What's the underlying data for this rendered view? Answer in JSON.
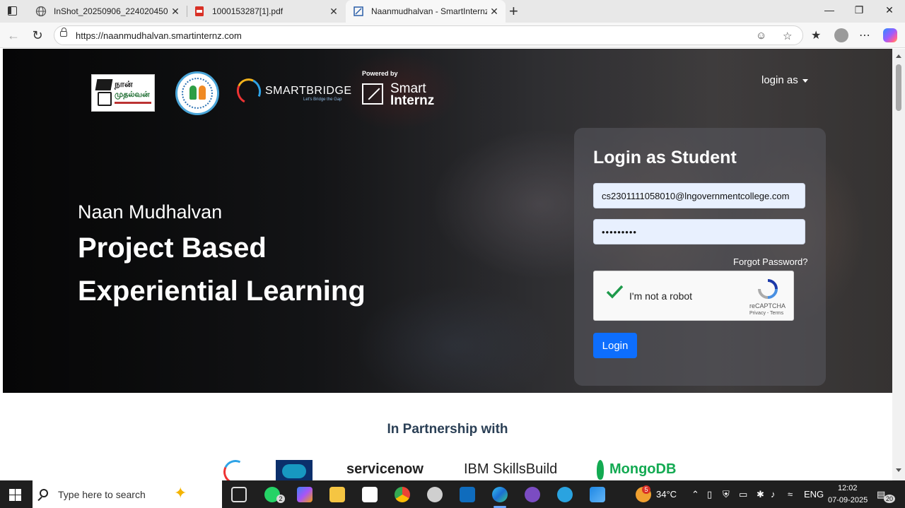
{
  "browser": {
    "tabs": [
      {
        "title": "InShot_20250906_224020450",
        "icon": "globe-icon"
      },
      {
        "title": "1000153287[1].pdf",
        "icon": "pdf-icon"
      },
      {
        "title": "Naanmudhalvan - SmartInternz",
        "icon": "web-page-icon",
        "active": true
      }
    ],
    "close_glyph": "✕",
    "new_tab_glyph": "+",
    "url": "https://naanmudhalvan.smartinternz.com"
  },
  "header": {
    "logos": {
      "naan_mudhalvan_line1": "நான்",
      "naan_mudhalvan_line2": "முதல்வன்",
      "smartbridge": "SMARTBRIDGE",
      "smartbridge_tagline": "Let's Bridge the Gap",
      "powered_by": "Powered by",
      "smart": "Smart",
      "internz": "Internz"
    },
    "login_as": "login as"
  },
  "hero": {
    "subtitle": "Naan Mudhalvan",
    "title_line1": "Project Based",
    "title_line2": "Experiential Learning"
  },
  "login": {
    "heading": "Login as Student",
    "email_value": "cs2301111058010@lngovernmentcollege.com",
    "password_value": "•••••••••",
    "forgot": "Forgot Password?",
    "captcha_label": "I'm not a robot",
    "captcha_brand": "reCAPTCHA",
    "captcha_links": "Privacy - Terms",
    "button": "Login",
    "accent_color": "#0d6efd"
  },
  "partners": {
    "heading": "In Partnership with",
    "salesforce": "salesforce",
    "servicenow": "servicenow",
    "ibm": "IBM SkillsBuild",
    "mongodb": "MongoDB"
  },
  "taskbar": {
    "search_placeholder": "Type here to search",
    "whatsapp_badge": "2",
    "weather_badge": "5",
    "weather": "34°C",
    "language": "ENG",
    "time": "12:02",
    "date": "07-09-2025",
    "notifications": "20"
  }
}
